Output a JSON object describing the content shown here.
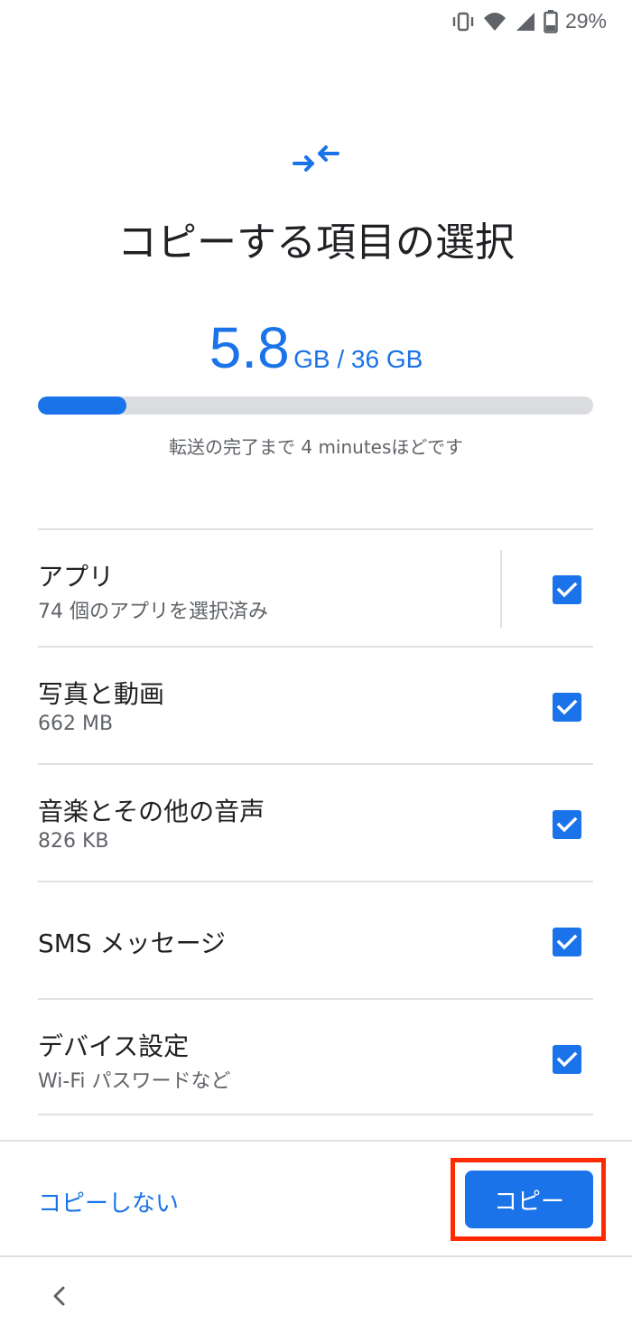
{
  "status_bar": {
    "battery_percent": "29%",
    "icons": [
      "vibrate-icon",
      "wifi-icon",
      "cell-signal-icon",
      "battery-icon"
    ]
  },
  "header": {
    "icon": "transfer-arrows-icon",
    "title": "コピーする項目の選択"
  },
  "storage": {
    "used": "5.8",
    "total_text": "GB / 36 GB",
    "progress_fraction": 0.16,
    "eta": "転送の完了まで 4 minutesほどです"
  },
  "items": [
    {
      "title": "アプリ",
      "subtitle": "74 個のアプリを選択済み",
      "checked": true
    },
    {
      "title": "写真と動画",
      "subtitle": "662 MB",
      "checked": true
    },
    {
      "title": "音楽とその他の音声",
      "subtitle": "826 KB",
      "checked": true
    },
    {
      "title": "SMS メッセージ",
      "subtitle": "",
      "checked": true
    },
    {
      "title": "デバイス設定",
      "subtitle": "Wi-Fi パスワードなど",
      "checked": true
    }
  ],
  "footer": {
    "skip_label": "コピーしない",
    "copy_label": "コピー"
  },
  "colors": {
    "accent": "#1a73e8",
    "highlight": "#ff2a00",
    "track": "#dadce0"
  }
}
